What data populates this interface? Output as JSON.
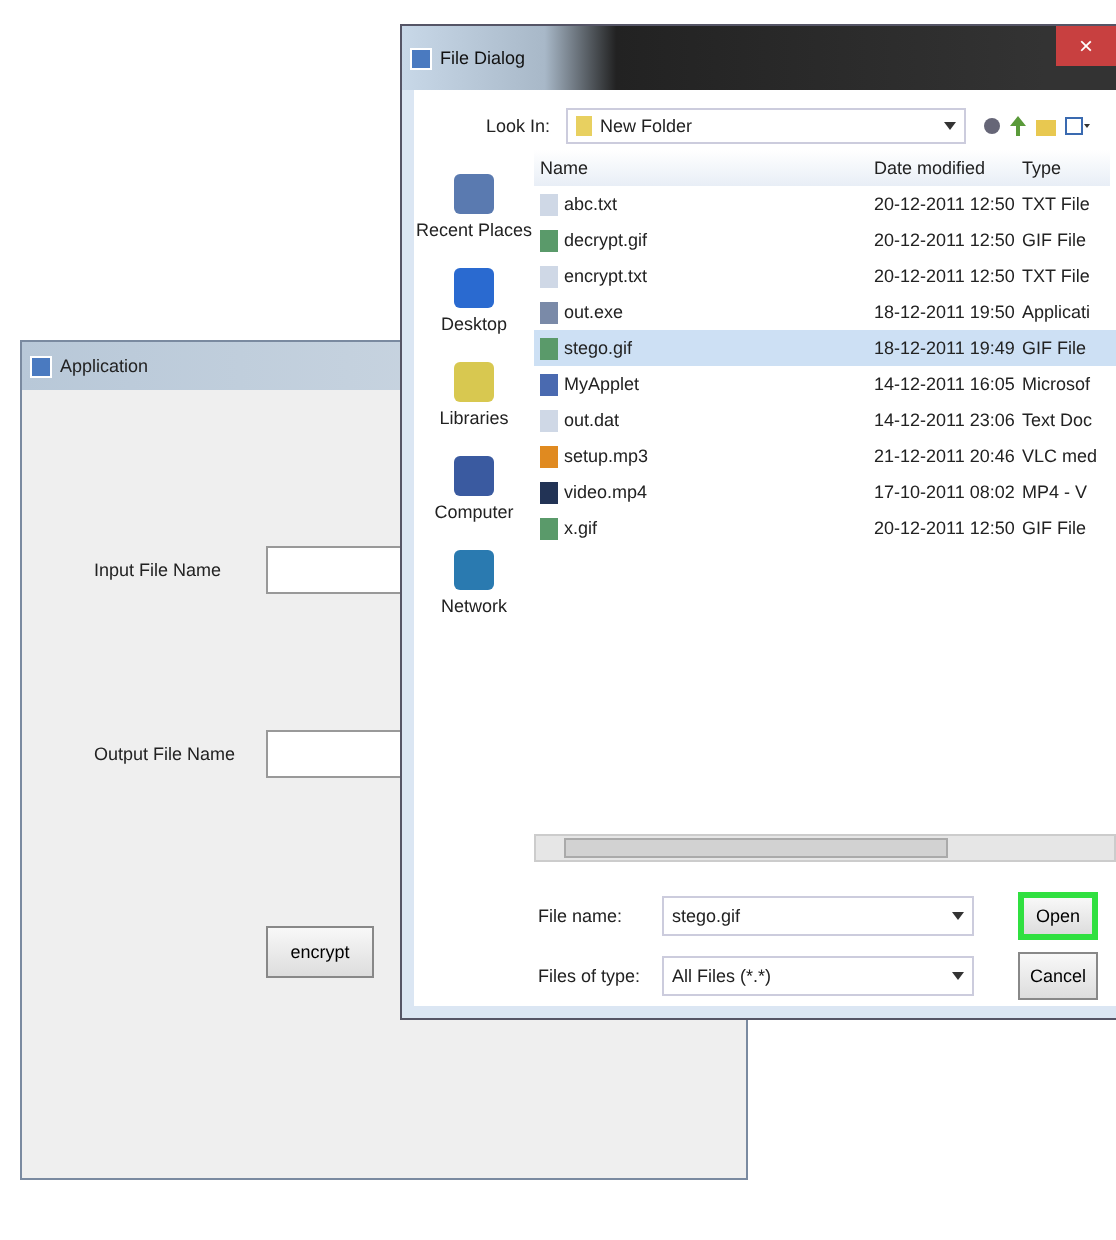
{
  "app_window": {
    "title": "Application",
    "input_label": "Input File Name",
    "output_label": "Output File Name",
    "button": "encrypt"
  },
  "dialog": {
    "title": "File Dialog",
    "close": "×",
    "look_in_label": "Look In:",
    "look_in_value": "New Folder",
    "sidebar": [
      {
        "label": "Recent Places",
        "kind": "recent"
      },
      {
        "label": "Desktop",
        "kind": "desktop"
      },
      {
        "label": "Libraries",
        "kind": "libraries"
      },
      {
        "label": "Computer",
        "kind": "computer"
      },
      {
        "label": "Network",
        "kind": "network"
      }
    ],
    "columns": [
      "Name",
      "Date modified",
      "Type"
    ],
    "files": [
      {
        "name": "abc.txt",
        "date": "20-12-2011 12:50",
        "type": "TXT File",
        "kind": "text",
        "selected": false
      },
      {
        "name": "decrypt.gif",
        "date": "20-12-2011 12:50",
        "type": "GIF File",
        "kind": "image",
        "selected": false
      },
      {
        "name": "encrypt.txt",
        "date": "20-12-2011 12:50",
        "type": "TXT File",
        "kind": "text",
        "selected": false
      },
      {
        "name": "out.exe",
        "date": "18-12-2011 19:50",
        "type": "Applicati",
        "kind": "app",
        "selected": false
      },
      {
        "name": "stego.gif",
        "date": "18-12-2011 19:49",
        "type": "GIF File",
        "kind": "image",
        "selected": true
      },
      {
        "name": "MyApplet",
        "date": "14-12-2011 16:05",
        "type": "Microsof",
        "kind": "doc",
        "selected": false
      },
      {
        "name": "out.dat",
        "date": "14-12-2011 23:06",
        "type": "Text Doc",
        "kind": "text",
        "selected": false
      },
      {
        "name": "setup.mp3",
        "date": "21-12-2011 20:46",
        "type": "VLC med",
        "kind": "vlc",
        "selected": false
      },
      {
        "name": "video.mp4",
        "date": "17-10-2011 08:02",
        "type": "MP4 - V",
        "kind": "video",
        "selected": false
      },
      {
        "name": "x.gif",
        "date": "20-12-2011 12:50",
        "type": "GIF File",
        "kind": "image",
        "selected": false
      }
    ],
    "file_name_label": "File name:",
    "file_name_value": "stego.gif",
    "file_type_label": "Files of type:",
    "file_type_value": "All Files (*.*)",
    "open_button": "Open",
    "cancel_button": "Cancel"
  }
}
